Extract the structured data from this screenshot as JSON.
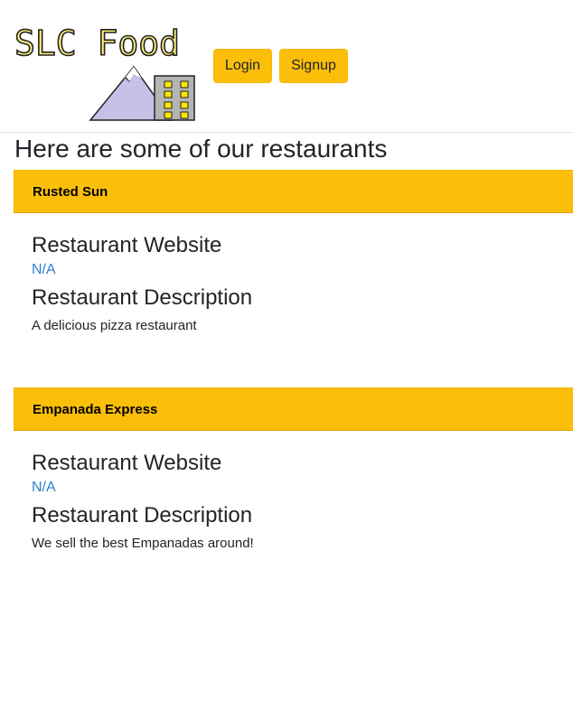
{
  "logo": {
    "text": "SLC Food",
    "colors": {
      "text_fill": "#fff07a",
      "mountain": "#c8c0e6",
      "building": "#b4b4b4",
      "windows": "#ffe600"
    }
  },
  "nav": {
    "login_label": "Login",
    "signup_label": "Signup",
    "button_color": "#fbbf0a"
  },
  "page": {
    "title": "Here are some of our restaurants"
  },
  "restaurants": [
    {
      "name": "Rusted Sun",
      "website_heading": "Restaurant Website",
      "website": "N/A",
      "description_heading": "Restaurant Description",
      "description": "A delicious pizza restaurant"
    },
    {
      "name": "Empanada Express",
      "website_heading": "Restaurant Website",
      "website": "N/A",
      "description_heading": "Restaurant Description",
      "description": "We sell the best Empanadas around!"
    }
  ]
}
